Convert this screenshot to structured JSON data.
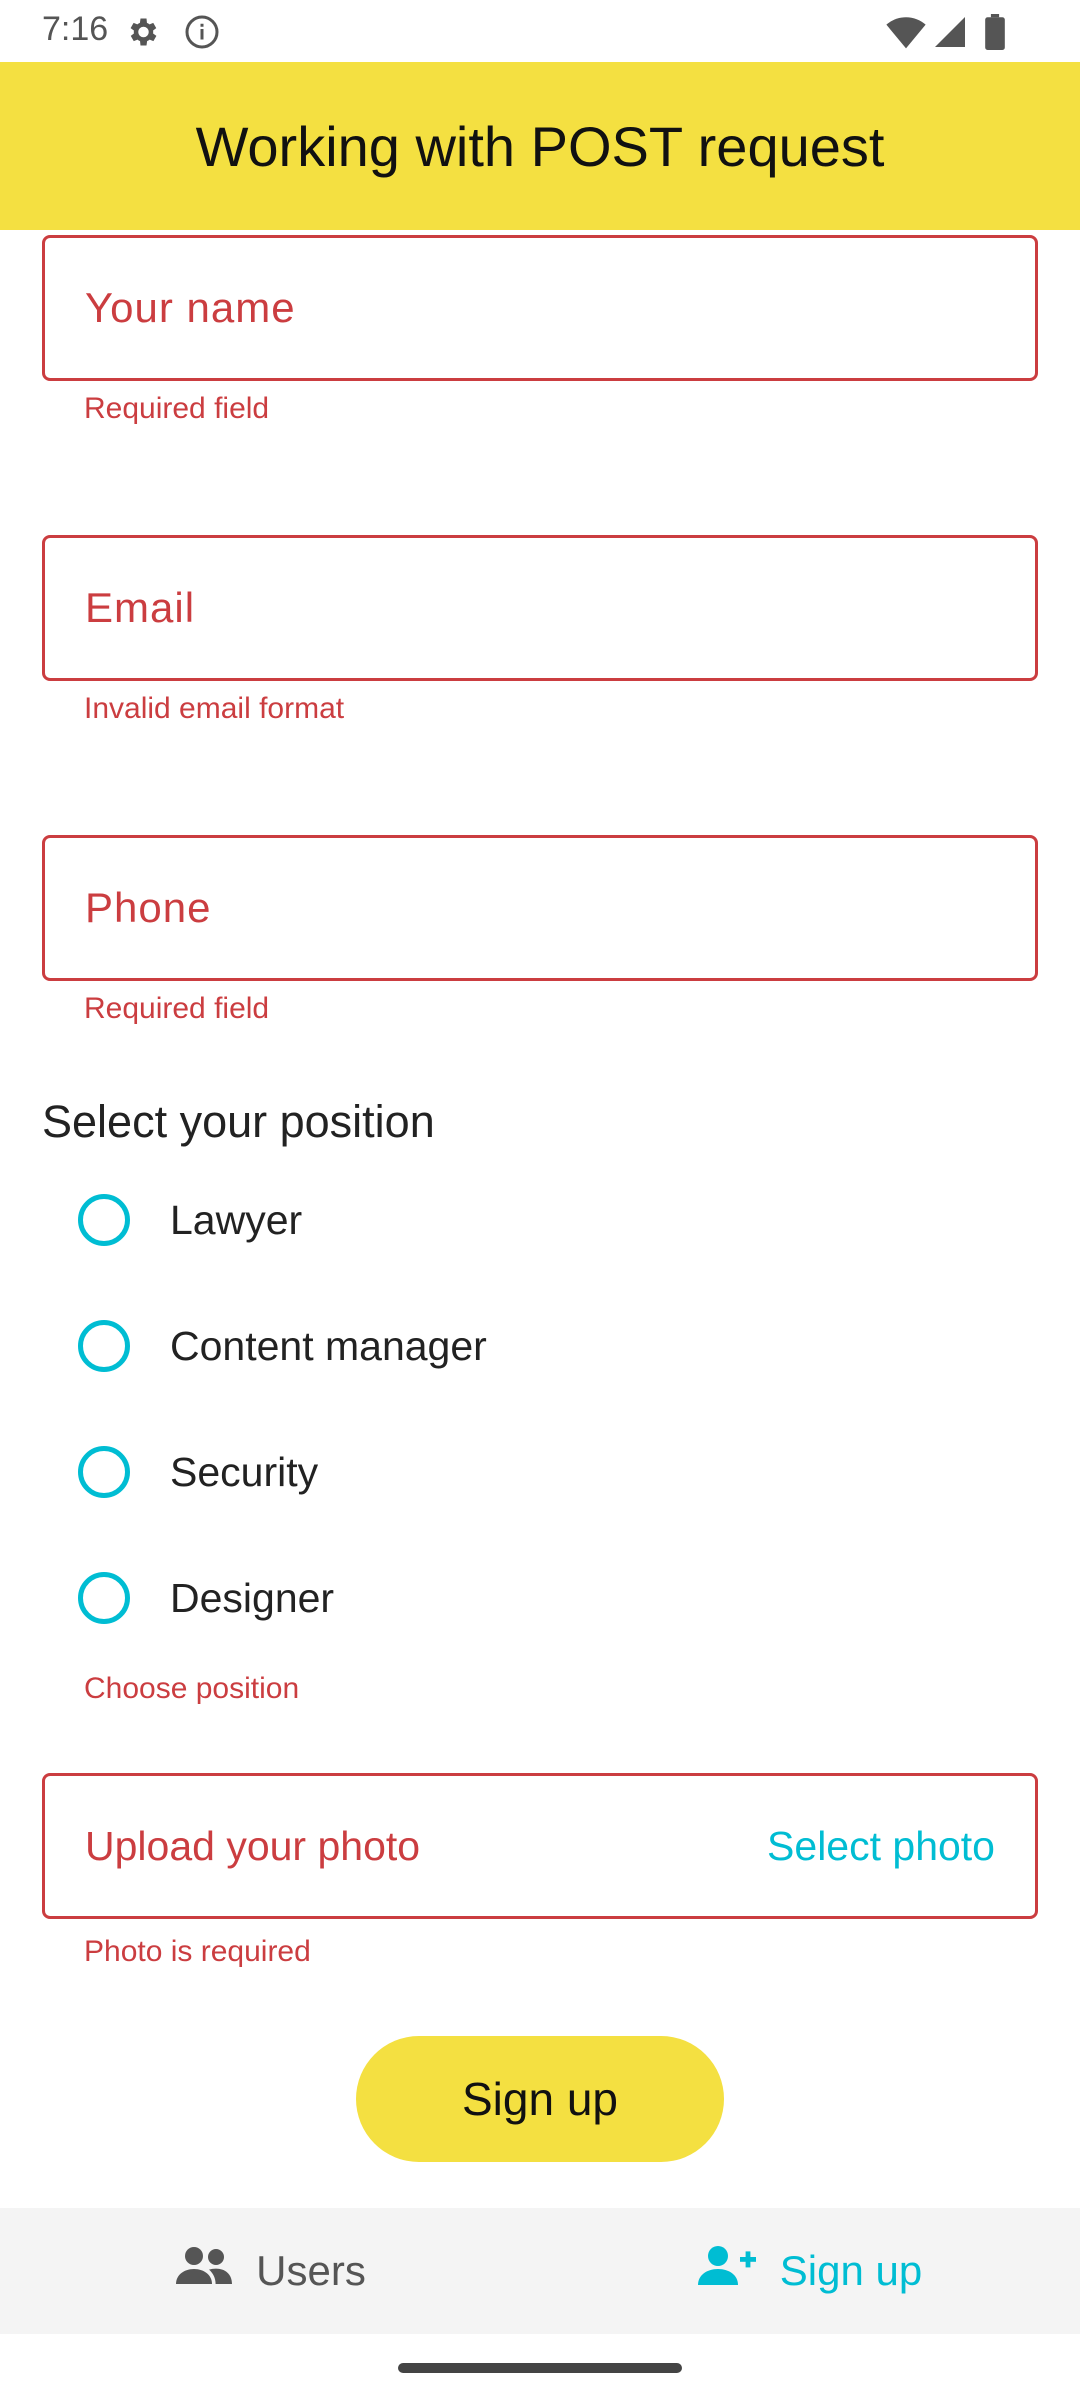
{
  "status_bar": {
    "time": "7:16"
  },
  "app_bar": {
    "title": "Working with POST request"
  },
  "form": {
    "name_field": {
      "label": "Your name",
      "error": "Required field"
    },
    "email_field": {
      "label": "Email",
      "error": "Invalid email format"
    },
    "phone_field": {
      "label": "Phone",
      "error": "Required field"
    },
    "position": {
      "title": "Select your position",
      "options": [
        "Lawyer",
        "Content manager",
        "Security",
        "Designer"
      ],
      "error": "Choose position"
    },
    "photo": {
      "label": "Upload your photo",
      "action": "Select photo",
      "error": "Photo is required"
    },
    "submit_label": "Sign up"
  },
  "bottom_nav": {
    "items": [
      {
        "label": "Users",
        "icon": "people-icon",
        "active": false
      },
      {
        "label": "Sign up",
        "icon": "person-add-icon",
        "active": true
      }
    ]
  },
  "colors": {
    "accent_yellow": "#F4E041",
    "accent_cyan": "#00BDD3",
    "error_red": "#CB3D40"
  }
}
